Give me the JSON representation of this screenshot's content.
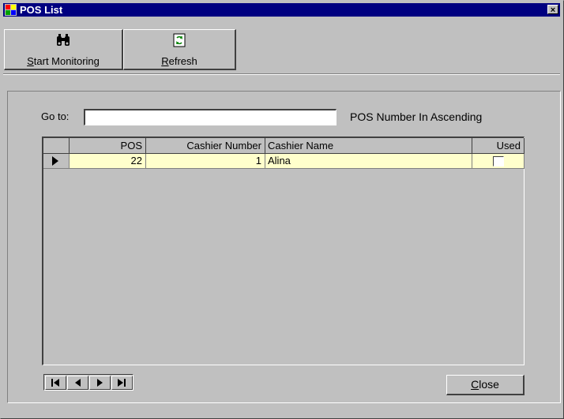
{
  "window": {
    "title": "POS List",
    "close_glyph": "×"
  },
  "toolbar": {
    "start_monitoring": {
      "accel": "S",
      "rest": "tart Monitoring",
      "icon": "binoculars-icon"
    },
    "refresh": {
      "accel": "R",
      "rest": "efresh",
      "icon": "refresh-icon"
    }
  },
  "goto": {
    "label": "Go to:",
    "value": ""
  },
  "sort_label": "POS Number In Ascending",
  "table": {
    "columns": [
      "POS",
      "Cashier Number",
      "Cashier Name",
      "Used"
    ],
    "rows": [
      {
        "pos": "22",
        "cashier_number": "1",
        "cashier_name": "Alina",
        "used": false
      }
    ]
  },
  "navigator": {
    "buttons": [
      "first-record",
      "previous-record",
      "next-record",
      "last-record"
    ]
  },
  "close_button": {
    "accel": "C",
    "rest": "lose"
  }
}
